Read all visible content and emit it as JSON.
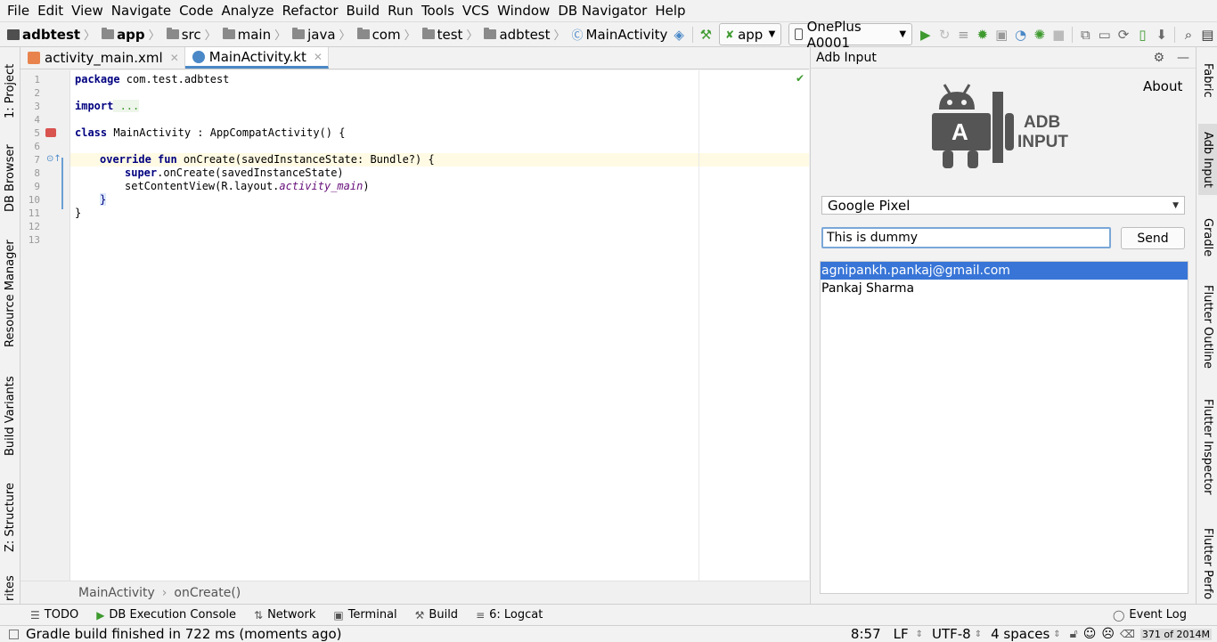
{
  "menu": [
    "File",
    "Edit",
    "View",
    "Navigate",
    "Code",
    "Analyze",
    "Refactor",
    "Build",
    "Run",
    "Tools",
    "VCS",
    "Window",
    "DB Navigator",
    "Help"
  ],
  "breadcrumbs": [
    "adbtest",
    "app",
    "src",
    "main",
    "java",
    "com",
    "test",
    "adbtest",
    "MainActivity"
  ],
  "run_config": "app",
  "device_config": "OnePlus A0001",
  "tabs": [
    {
      "label": "activity_main.xml"
    },
    {
      "label": "MainActivity.kt"
    }
  ],
  "code": {
    "line_numbers": [
      "1",
      "2",
      "3",
      "4",
      "5",
      "6",
      "7",
      "8",
      "9",
      "10",
      "11",
      "12",
      "13"
    ],
    "package_kw": "package",
    "package_name": " com.test.adbtest",
    "import_kw": "import",
    "import_rest": " ...",
    "class_kw": "class",
    "class_rest": " MainActivity : AppCompatActivity() {",
    "override_kw": "override fun",
    "override_rest": " onCreate(savedInstanceState: Bundle?) {",
    "super_kw": "super",
    "super_rest": ".onCreate(savedInstanceState)",
    "setcontent": "setContentView(R.layout.",
    "layout_name": "activity_main",
    "close_paren": ")",
    "brace_inner": "}",
    "brace_outer": "}"
  },
  "editor_breadcrumb": [
    "MainActivity",
    "onCreate()"
  ],
  "left_tool_tabs": [
    "1: Project",
    "DB Browser",
    "Resource Manager",
    "Build Variants",
    "Z: Structure",
    "rites"
  ],
  "right_tool_tabs": [
    "Fabric",
    "Adb Input",
    "Gradle",
    "Flutter Outline",
    "Flutter Inspector",
    "Flutter Perfo"
  ],
  "adb_panel": {
    "title": "Adb Input",
    "about": "About",
    "logo_text_line1": "ADB",
    "logo_text_line2": "INPUT",
    "logo_letter": "A",
    "device_selected": "Google Pixel",
    "input_value": "This is dummy",
    "send_label": "Send",
    "history": [
      "agnipankh.pankaj@gmail.com",
      "Pankaj Sharma"
    ]
  },
  "bottom_tool_windows": [
    "TODO",
    "DB Execution Console",
    "Network",
    "Terminal",
    "Build",
    "6: Logcat"
  ],
  "event_log": "Event Log",
  "status": {
    "message": "Gradle build finished in 722 ms (moments ago)",
    "position": "8:57",
    "line_sep": "LF",
    "encoding": "UTF-8",
    "indent": "4 spaces",
    "memory": "371 of 2014M"
  },
  "colors": {
    "accent": "#4a88c7",
    "selection": "#3875d7",
    "current_line": "#fffae3",
    "run_green": "#3e9a2f"
  }
}
